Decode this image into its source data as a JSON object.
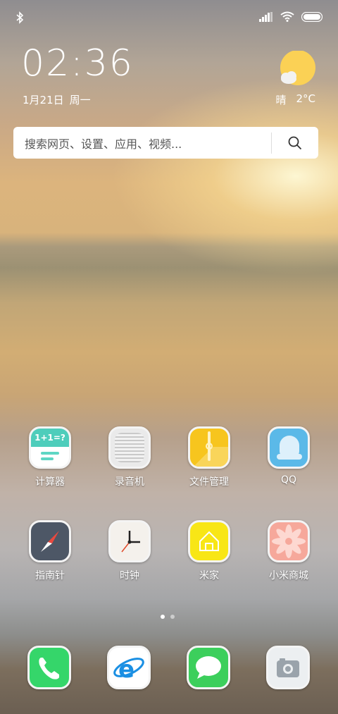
{
  "status_bar": {
    "bluetooth_icon": "bluetooth-icon",
    "signal_icon": "signal-icon",
    "wifi_icon": "wifi-icon",
    "battery_icon": "battery-icon"
  },
  "clock": {
    "time": "02:36",
    "date": "1月21日",
    "weekday": "周一"
  },
  "weather": {
    "condition": "晴",
    "temperature": "2°C"
  },
  "search": {
    "placeholder": "搜索网页、设置、应用、视频..."
  },
  "apps": [
    {
      "label": "计算器"
    },
    {
      "label": "录音机"
    },
    {
      "label": "文件管理"
    },
    {
      "label": "QQ"
    },
    {
      "label": "指南针"
    },
    {
      "label": "时钟"
    },
    {
      "label": "米家"
    },
    {
      "label": "小米商城"
    }
  ],
  "calculator_display": "1+1=?",
  "page_indicator": {
    "total": 2,
    "current": 1
  },
  "dock": [
    {
      "icon": "phone-icon"
    },
    {
      "icon": "browser-icon"
    },
    {
      "icon": "messages-icon"
    },
    {
      "icon": "camera-icon"
    }
  ]
}
